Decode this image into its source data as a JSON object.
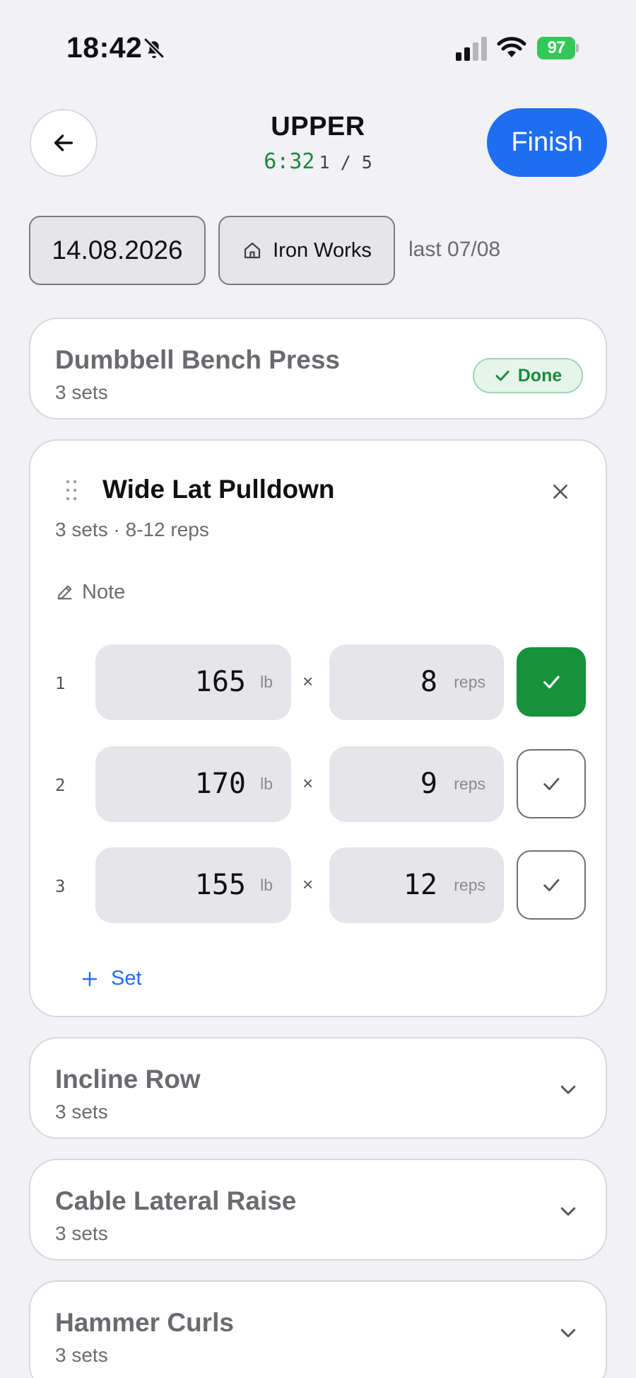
{
  "status_bar": {
    "time": "18:42",
    "battery": "97"
  },
  "header": {
    "title": "UPPER",
    "timer": "6:32",
    "progress": "1 / 5",
    "finish_label": "Finish"
  },
  "meta": {
    "date": "14.08.2026",
    "gym": "Iron Works",
    "last": "last 07/08"
  },
  "exercises": {
    "done": {
      "name": "Dumbbell Bench Press",
      "sets": "3 sets",
      "badge": "Done"
    },
    "active": {
      "name": "Wide Lat Pulldown",
      "detail": "3 sets · 8-12 reps",
      "note_label": "Note",
      "add_set_label": "Set",
      "sets": [
        {
          "num": "1",
          "weight": "165",
          "weight_unit": "lb",
          "reps": "8",
          "reps_unit": "reps",
          "completed": true
        },
        {
          "num": "2",
          "weight": "170",
          "weight_unit": "lb",
          "reps": "9",
          "reps_unit": "reps",
          "completed": false
        },
        {
          "num": "3",
          "weight": "155",
          "weight_unit": "lb",
          "reps": "12",
          "reps_unit": "reps",
          "completed": false
        }
      ]
    },
    "collapsed": [
      {
        "name": "Incline Row",
        "sets": "3 sets"
      },
      {
        "name": "Cable Lateral Raise",
        "sets": "3 sets"
      },
      {
        "name": "Hammer Curls",
        "sets": "3 sets"
      }
    ]
  },
  "colors": {
    "accent_blue": "#1f6ef0",
    "success_green": "#16913c",
    "battery_green": "#34c759"
  },
  "icons": [
    "bell-slash-icon",
    "cellular-signal-icon",
    "wifi-icon",
    "battery-icon",
    "arrow-left-icon",
    "home-icon",
    "check-icon",
    "drag-handle-icon",
    "close-icon",
    "pencil-icon",
    "plus-icon",
    "chevron-down-icon"
  ]
}
